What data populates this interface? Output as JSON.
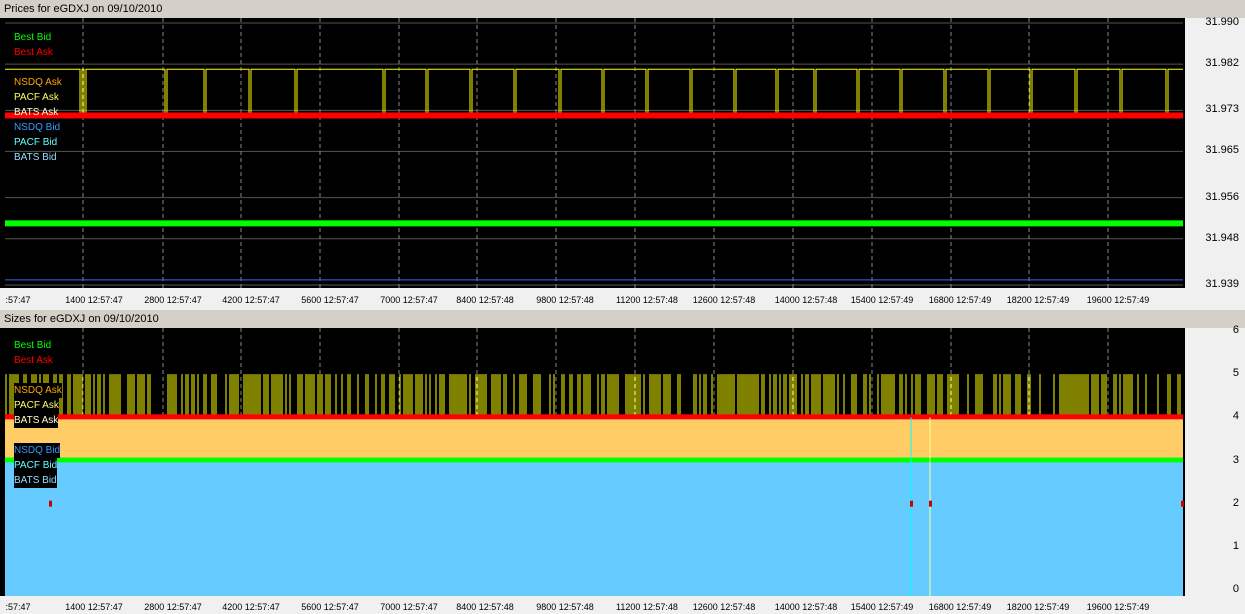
{
  "chart_data": [
    {
      "type": "line",
      "title": "Prices for  eGDXJ  on  09/10/2010",
      "y_ticks": [
        "31.990",
        "31.982",
        "31.973",
        "31.965",
        "31.956",
        "31.948",
        "31.939"
      ],
      "y_tick_values": [
        31.99,
        31.982,
        31.973,
        31.965,
        31.956,
        31.948,
        31.939
      ],
      "ylim": [
        31.939,
        31.99
      ],
      "x_ticks": [
        ":57:47",
        "1400 12:57:47",
        "2800 12:57:47",
        "4200 12:57:47",
        "5600 12:57:47",
        "7000 12:57:47",
        "8400 12:57:48",
        "9800 12:57:48",
        "11200 12:57:48",
        "12600 12:57:48",
        "14000 12:57:48",
        "15400 12:57:49",
        "16800 12:57:49",
        "18200 12:57:49",
        "19600 12:57:49"
      ],
      "legend": [
        "Best Bid",
        "Best Ask",
        "NSDQ Ask",
        "PACF Ask",
        "BATS Ask",
        "NSDQ Bid",
        "PACF Bid",
        "BATS Bid"
      ],
      "legend_placement": "top-left",
      "grid": true,
      "series": [
        {
          "name": "Best Ask",
          "values_constant": 31.972,
          "color": "#ff0000"
        },
        {
          "name": "NSDQ Ask",
          "values_constant": 31.981,
          "color": "#ffff00"
        },
        {
          "name": "Best Bid",
          "values_constant": 31.951,
          "color": "#00ff00"
        },
        {
          "name": "BATS Bid",
          "values_constant": 31.94,
          "color": "#3366ff"
        }
      ]
    },
    {
      "type": "area",
      "title": "Sizes for  eGDXJ  on  09/10/2010",
      "y_ticks": [
        "6",
        "5",
        "4",
        "3",
        "2",
        "1",
        "0"
      ],
      "y_tick_values": [
        6,
        5,
        4,
        3,
        2,
        1,
        0
      ],
      "ylim": [
        0,
        6
      ],
      "x_ticks": [
        ":57:47",
        "1400 12:57:47",
        "2800 12:57:47",
        "4200 12:57:47",
        "5600 12:57:47",
        "7000 12:57:47",
        "8400 12:57:48",
        "9800 12:57:48",
        "11200 12:57:48",
        "12600 12:57:48",
        "14000 12:57:48",
        "15400 12:57:49",
        "16800 12:57:49",
        "18200 12:57:49",
        "19600 12:57:49"
      ],
      "legend": [
        "Best Bid",
        "Best Ask",
        "NSDQ Ask",
        "PACF Ask",
        "BATS Ask",
        "NSDQ Bid",
        "PACF Bid",
        "BATS Bid"
      ],
      "legend_placement": "top-left",
      "series": [
        {
          "name": "NSDQ Ask",
          "values_constant": 5,
          "color": "#ffff00"
        },
        {
          "name": "Best Ask",
          "values_constant": 4,
          "color": "#ff0000"
        },
        {
          "name": "Best Bid",
          "values_constant": 3,
          "color": "#00ff00"
        },
        {
          "name": "BATS Ask",
          "values_constant": 4,
          "color": "#ffcc66"
        },
        {
          "name": "BATS Bid",
          "values_constant": 3,
          "color": "#66ccff"
        }
      ]
    }
  ],
  "colors": {
    "best_bid": "#00ff00",
    "best_ask": "#ff0000",
    "nsdq_ask": "#ffa500",
    "pacf_ask": "#ffff66",
    "bats_ask": "#ffff99",
    "nsdq_bid": "#3399ff",
    "pacf_bid": "#66ffff",
    "bats_bid": "#99ddff"
  }
}
